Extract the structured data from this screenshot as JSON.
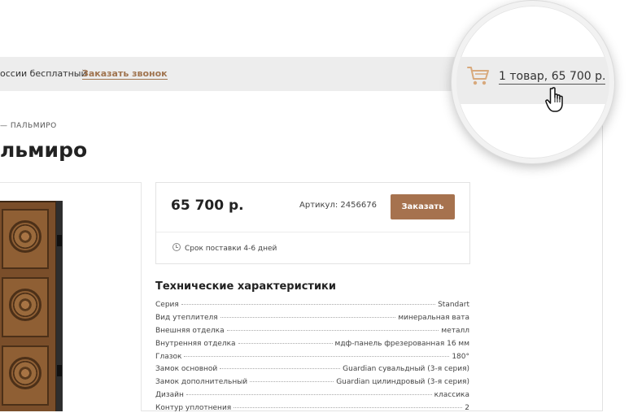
{
  "header": {
    "free_shipping": "оссии бесплатный",
    "callback_link": "Заказать звонок",
    "cart_summary": "1 товар, 65 700 р."
  },
  "breadcrumb": "— ПАЛЬМИРО",
  "page_title": "льмиро",
  "product": {
    "price": "65 700 р.",
    "sku": "Артикул: 2456676",
    "order_button": "Заказать",
    "delivery": "Срок поставки 4-6 дней"
  },
  "specs": {
    "title": "Технические характеристики",
    "rows": [
      {
        "key": "Серия",
        "value": "Standart"
      },
      {
        "key": "Вид утеплителя",
        "value": "минеральная вата"
      },
      {
        "key": "Внешняя отделка",
        "value": "металл"
      },
      {
        "key": "Внутренняя отделка",
        "value": "мдф-панель фрезерованная 16 мм"
      },
      {
        "key": "Глазок",
        "value": "180°"
      },
      {
        "key": "Замок основной",
        "value": "Guardian сувальдный (3-я серия)"
      },
      {
        "key": "Замок дополнительный",
        "value": "Guardian цилиндровый (3-я серия)"
      },
      {
        "key": "Дизайн",
        "value": "классика"
      },
      {
        "key": "Контур уплотнения",
        "value": "2"
      }
    ]
  },
  "colors": {
    "accent": "#a6724e",
    "link": "#a0744f",
    "topbar": "#ededed",
    "cart_icon": "#d8a97c"
  },
  "icons": [
    "cart-icon",
    "hand-cursor-icon",
    "clock-icon"
  ]
}
